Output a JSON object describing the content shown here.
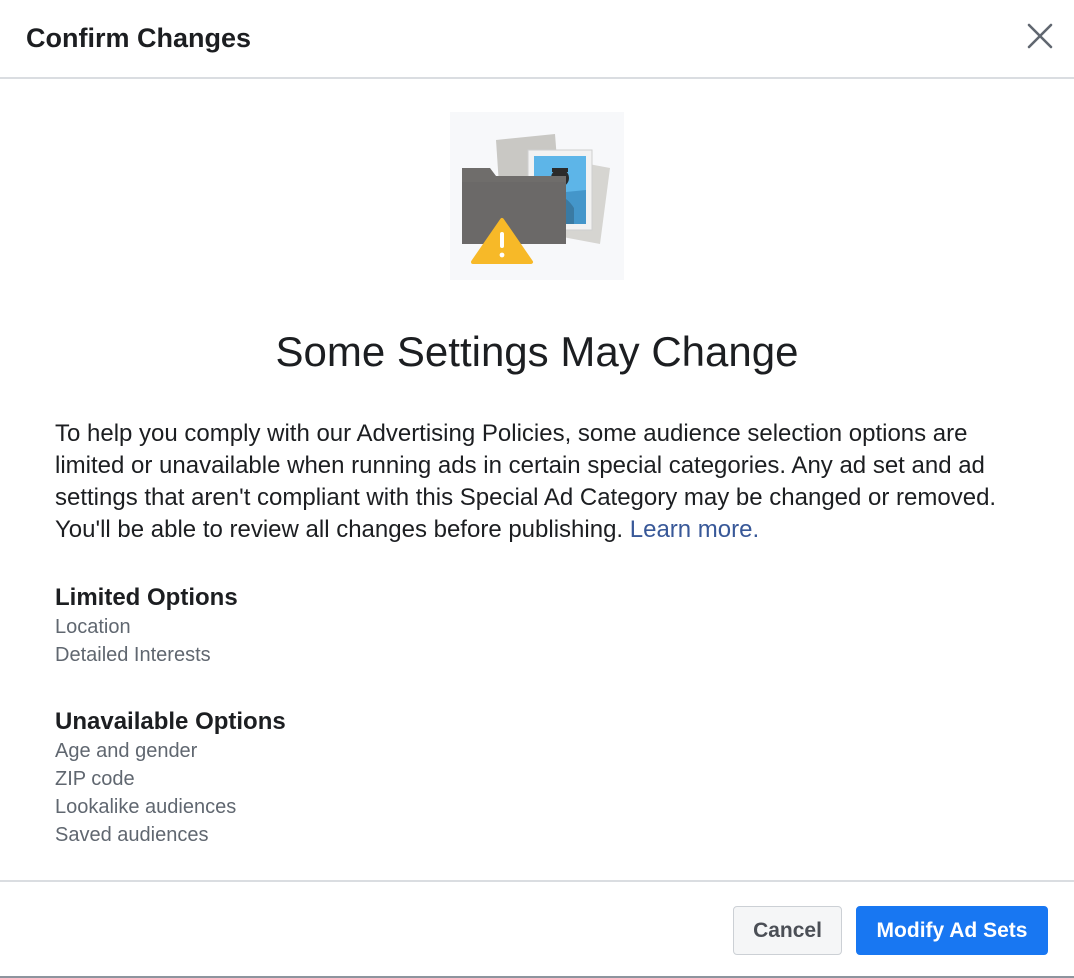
{
  "dialog": {
    "title": "Confirm Changes",
    "close_icon": "close-icon",
    "illustration_icon": "folder-warning-illustration"
  },
  "content": {
    "heading": "Some Settings May Change",
    "body": "To help you comply with our Advertising Policies, some audience selection options are limited or unavailable when running ads in certain special categories. Any ad set and ad settings that aren't compliant with this Special Ad Category may be changed or removed. You'll be able to review all changes before publishing. ",
    "learn_more": "Learn more."
  },
  "limited": {
    "title": "Limited Options",
    "items": [
      "Location",
      "Detailed Interests"
    ]
  },
  "unavailable": {
    "title": "Unavailable Options",
    "items": [
      "Age and gender",
      "ZIP code",
      "Lookalike audiences",
      "Saved audiences"
    ]
  },
  "footer": {
    "cancel_label": "Cancel",
    "primary_label": "Modify Ad Sets"
  },
  "colors": {
    "primary": "#1877f2",
    "link": "#385898",
    "muted_text": "#606770",
    "warning": "#f7b928"
  }
}
